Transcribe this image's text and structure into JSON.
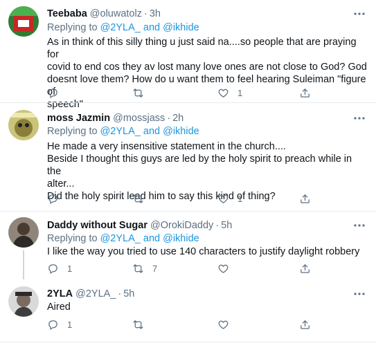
{
  "tweets": [
    {
      "name": "Teebaba",
      "handle": "@oluwatolz",
      "time": "3h",
      "replying_label": "Replying to",
      "mention_1": "@2YLA_",
      "and_label": "and",
      "mention_2": "@ikhide",
      "text": "As in think of this silly thing u just said na....so people that are praying for\ncovid to end cos they av lost many love ones are not close to God? God\ndoesnt love them? How do u want them to feel hearing Suleiman \"figure of\nspeech\"",
      "replies": "",
      "retweets": "",
      "likes": "1"
    },
    {
      "name": "moss Jazmin",
      "handle": "@mossjass",
      "time": "2h",
      "replying_label": "Replying to",
      "mention_1": "@2YLA_",
      "and_label": "and",
      "mention_2": "@ikhide",
      "text": "He made a very insensitive statement in the church....\nBeside I thought this guys are led by the holy spirit to preach while in the\nalter...\nDid the holy spirit lead him to say this kind of thing?",
      "replies": "",
      "retweets": "",
      "likes": "1"
    },
    {
      "name": "Daddy without Sugar",
      "handle": "@OrokiDaddy",
      "time": "5h",
      "replying_label": "Replying to",
      "mention_1": "@2YLA_",
      "and_label": "and",
      "mention_2": "@ikhide",
      "text": "I like the way you tried to use 140 characters to justify daylight robbery",
      "replies": "1",
      "retweets": "7",
      "likes": ""
    },
    {
      "name": "2YLA",
      "handle": "@2YLA_",
      "time": "5h",
      "text": "Aired",
      "replies": "1",
      "retweets": "",
      "likes": ""
    }
  ],
  "separator": "·",
  "icons": [
    "more-icon",
    "reply-icon",
    "retweet-icon",
    "like-icon",
    "share-icon"
  ],
  "colors": {
    "text": "#0f1419",
    "secondary": "#5b7083",
    "link": "#1b95e0",
    "border": "#e6ecf0"
  }
}
